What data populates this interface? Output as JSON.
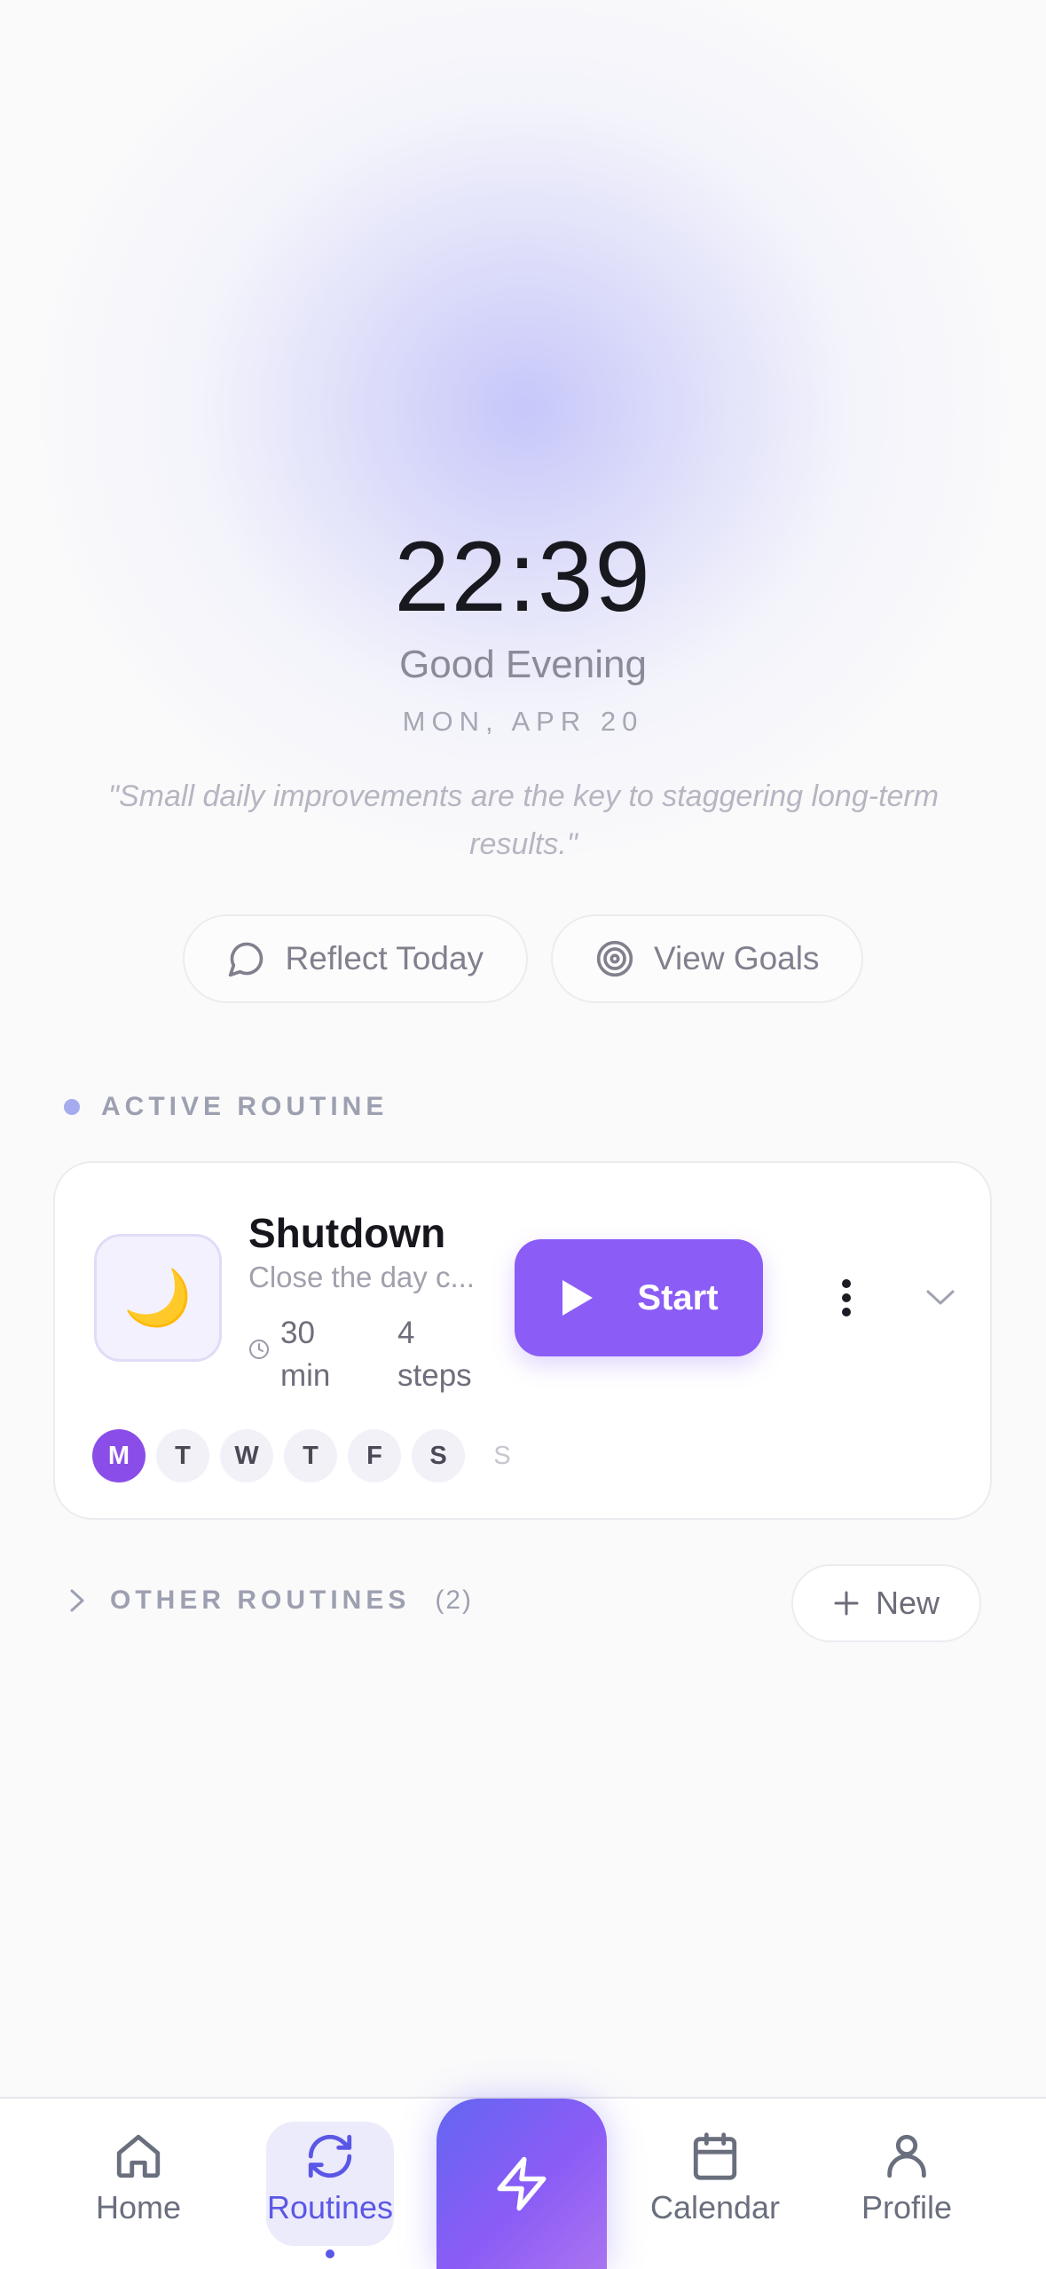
{
  "hero": {
    "time": "22:39",
    "greeting": "Good Evening",
    "date": "MON, APR 20",
    "quote": "\"Small daily improvements are the key to staggering long-term results.\""
  },
  "actions": {
    "reflect_label": "Reflect Today",
    "goals_label": "View Goals"
  },
  "active_section": {
    "label": "ACTIVE ROUTINE"
  },
  "routine": {
    "emoji": "🌙",
    "title": "Shutdown",
    "description": "Close the day c...",
    "duration": "30 min",
    "steps": "4 steps",
    "start_label": "Start",
    "days": [
      "M",
      "T",
      "W",
      "T",
      "F",
      "S",
      "S"
    ],
    "active_day_index": 0
  },
  "other_section": {
    "label": "OTHER ROUTINES",
    "count": "(2)",
    "new_label": "New"
  },
  "tabbar": {
    "home": "Home",
    "routines": "Routines",
    "calendar": "Calendar",
    "profile": "Profile",
    "active_tab": "routines"
  },
  "colors": {
    "accent": "#8b5cf6",
    "tab_active": "#5b57e6",
    "fab_gradient_start": "#6366f1",
    "fab_gradient_end": "#a974f0"
  }
}
